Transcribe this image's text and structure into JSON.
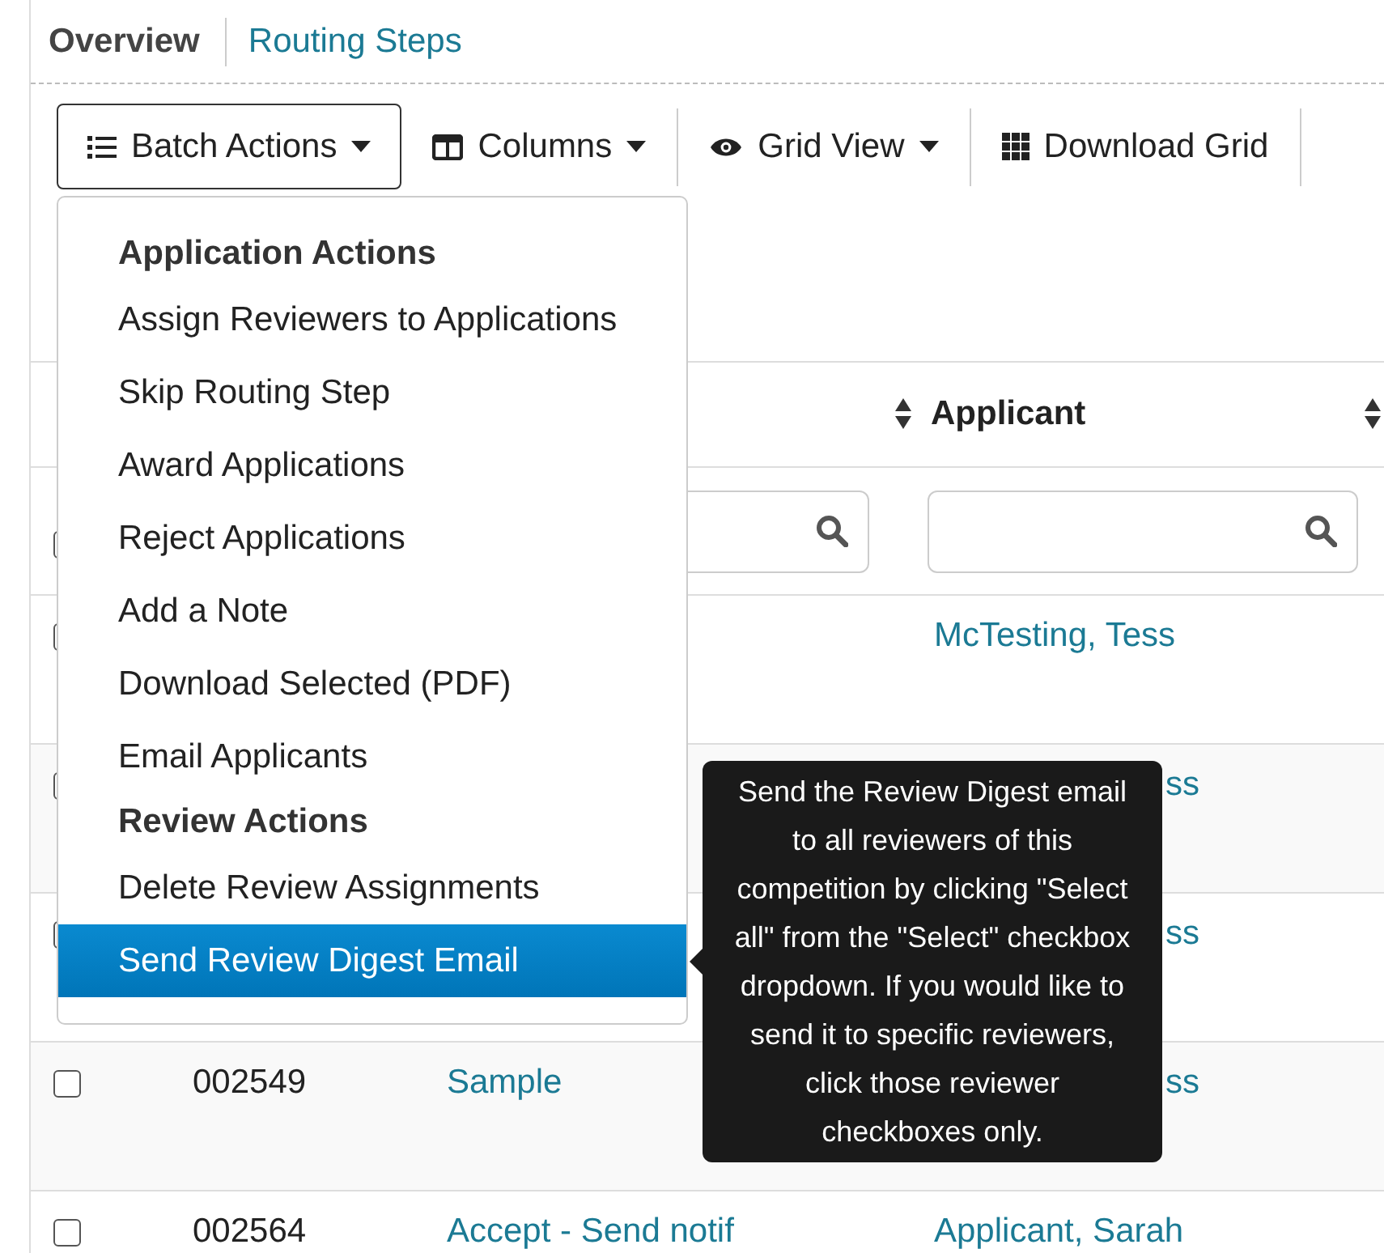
{
  "tabs": [
    {
      "label": "Overview",
      "selected": true
    },
    {
      "label": "Routing Steps",
      "selected": false
    }
  ],
  "toolbar": [
    {
      "label": "Batch Actions",
      "kind": "list",
      "dropdown": true,
      "open": true
    },
    {
      "label": "Columns",
      "kind": "columns",
      "dropdown": true,
      "open": false
    },
    {
      "label": "Grid View",
      "kind": "eye",
      "dropdown": true,
      "open": false
    },
    {
      "label": "Download Grid",
      "kind": "grid",
      "dropdown": false,
      "open": false
    }
  ],
  "batch_menu": [
    {
      "kind": "header",
      "label": "Application Actions"
    },
    {
      "kind": "item",
      "label": "Assign Reviewers to Applications",
      "selected": false
    },
    {
      "kind": "item",
      "label": "Skip Routing Step",
      "selected": false
    },
    {
      "kind": "item",
      "label": "Award Applications",
      "selected": false
    },
    {
      "kind": "item",
      "label": "Reject Applications",
      "selected": false
    },
    {
      "kind": "item",
      "label": "Add a Note",
      "selected": false
    },
    {
      "kind": "item",
      "label": "Download Selected (PDF)",
      "selected": false
    },
    {
      "kind": "item",
      "label": "Email Applicants",
      "selected": false
    },
    {
      "kind": "header",
      "label": "Review Actions"
    },
    {
      "kind": "item",
      "label": "Delete Review Assignments",
      "selected": false
    },
    {
      "kind": "item",
      "label": "Send Review Digest Email",
      "selected": true
    }
  ],
  "tooltip": {
    "text": "Send the Review Digest email to all reviewers of this competition by clicking \"Select all\" from the \"Select\" checkbox dropdown. If you would like to send it to specific reviewers, click those reviewer checkboxes only."
  },
  "table": {
    "columns": [
      {
        "label": "Applicant",
        "sortable": true
      },
      {
        "sortable": true
      }
    ],
    "filters": [
      {
        "kind": "checkbox",
        "checked": false
      },
      {
        "kind": "none"
      },
      {
        "kind": "search"
      },
      {
        "kind": "search"
      }
    ],
    "rows": [
      {
        "checked": false,
        "applicant": "McTesting, Tess"
      },
      {
        "checked": false,
        "applicant_tail": "ss"
      },
      {
        "checked": false,
        "applicant_tail": "ss"
      },
      {
        "checked": false,
        "id": "002549",
        "title": "Sample",
        "applicant_tail": "ss"
      },
      {
        "checked": false,
        "id": "002564",
        "title": "Accept - Send notif",
        "applicant": "Applicant, Sarah"
      }
    ]
  }
}
